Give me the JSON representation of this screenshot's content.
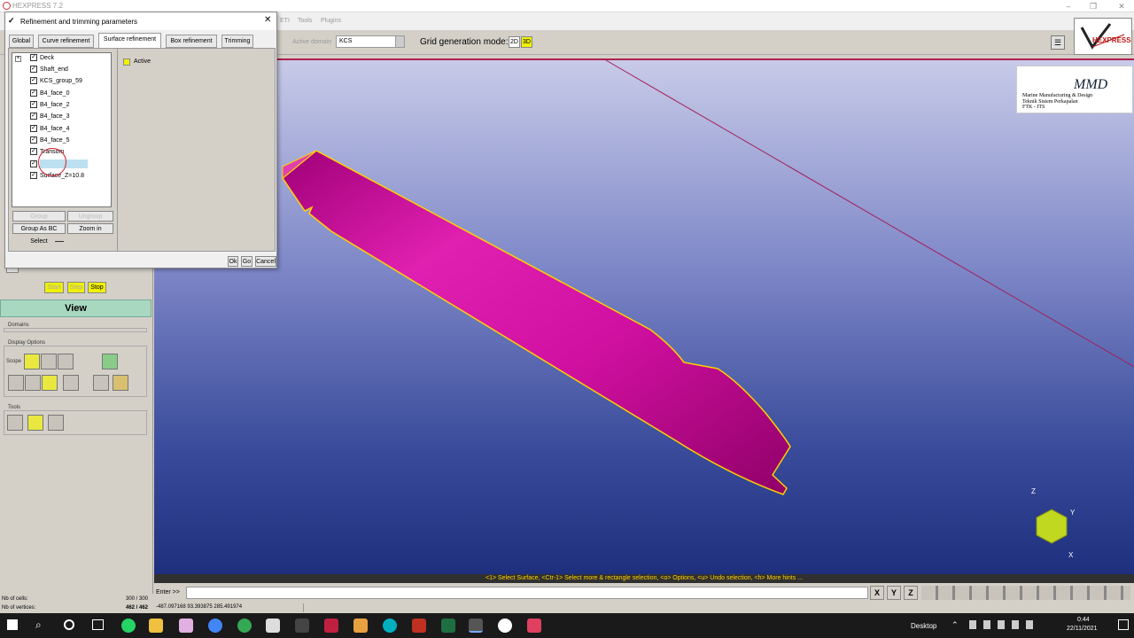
{
  "app": {
    "title": "HEXPRESS 7.2"
  },
  "menubar": {
    "items": [
      "ETI",
      "Tools",
      "Plugins"
    ]
  },
  "toolbar": {
    "active_domain_label": "Active domain",
    "active_domain_value": "KCS",
    "grid_mode_label": "Grid generation mode:",
    "mode_2d": "2D",
    "mode_3d": "3D"
  },
  "logo": {
    "text": "HEXPRESS"
  },
  "dialog": {
    "title": "Refinement and trimming parameters",
    "tabs": [
      "Global",
      "Curve refinement",
      "Surface refinement",
      "Box refinement",
      "Trimming"
    ],
    "active_tab": "Surface refinement",
    "tree": [
      "Deck",
      "Shaft_end",
      "KCS_group_59",
      "B4_face_0",
      "B4_face_2",
      "B4_face_3",
      "B4_face_4",
      "B4_face_5",
      "Transom",
      "",
      "Surface_Z=10.8"
    ],
    "active_label": "Active",
    "buttons": {
      "group": "Group",
      "ungroup": "Ungroup",
      "group_bc": "Group As BC",
      "zoom_in": "Zoom in",
      "select": "Select",
      "ok": "Ok",
      "go": "Go",
      "cancel": "Cancel"
    }
  },
  "left": {
    "start": "Start",
    "step": "Step",
    "stop": "Stop",
    "view": "View",
    "domains": "Domains",
    "display_options": "Display Options",
    "scope": "Scope",
    "tools": "Tools",
    "cells_label": "Nb of cells:",
    "cells_value": "300 / 300",
    "vertices_label": "Nb of vertices:",
    "vertices_value": "462 / 462"
  },
  "watermark": {
    "brand": "MMD",
    "line1": "Marine Manufacturing & Design",
    "line2": "Teknik Sistem Perkapalan",
    "line3": "FTK - ITS"
  },
  "axes": {
    "z": "Z",
    "y": "Y",
    "x": "X"
  },
  "hint": "<1> Select Surface, <Ctr-1> Select more & rectangle selection, <o> Options, <u> Undo selection, <h> More hints ...",
  "enter_label": "Enter >>",
  "coords": "-487.097168  93.393875  285.491974",
  "taskbar": {
    "desktop": "Desktop",
    "time": "0:44",
    "date": "22/11/2021"
  },
  "colors": {
    "hull": "#d0109a",
    "hull_edge": "#ffd000",
    "accent": "#f0f000",
    "view_bar": "#a8d8c0"
  }
}
